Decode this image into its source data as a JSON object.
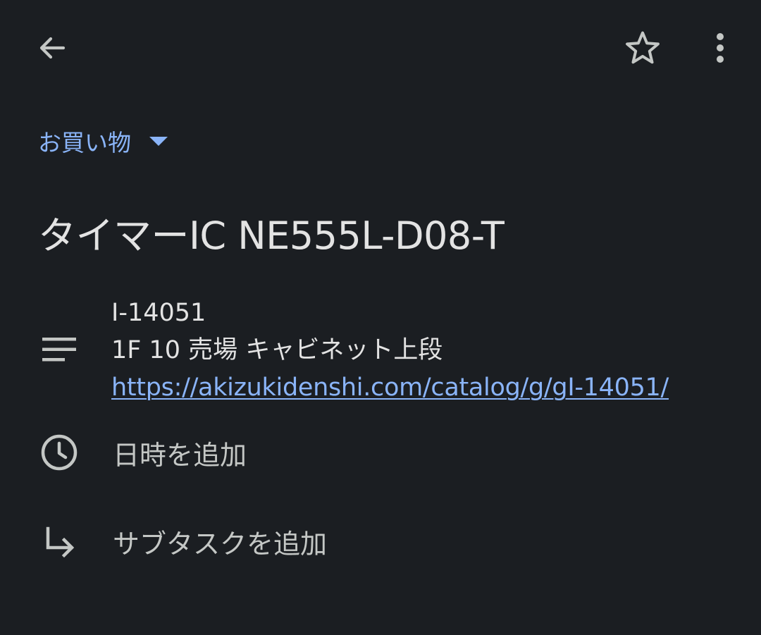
{
  "header": {
    "back_icon": "arrow-left-icon",
    "star_icon": "star-outline-icon",
    "more_icon": "more-vert-icon"
  },
  "list_selector": {
    "label": "お買い物",
    "icon": "dropdown-arrow-icon"
  },
  "task": {
    "title": "タイマーIC NE555L-D08-T",
    "details": {
      "icon": "notes-icon",
      "lines": [
        "I-14051",
        "1F 10 売場 キャビネット上段"
      ],
      "link": "https://akizukidenshi.com/catalog/g/gI-14051/"
    },
    "add_date": {
      "icon": "clock-icon",
      "label": "日時を追加"
    },
    "add_subtask": {
      "icon": "subdirectory-arrow-icon",
      "label": "サブタスクを追加"
    }
  },
  "colors": {
    "background": "#1b1e22",
    "accent": "#8ab4f8",
    "text_primary": "#e3e3e3",
    "text_secondary": "#c4c7c5",
    "icon": "#c4c7c5"
  }
}
